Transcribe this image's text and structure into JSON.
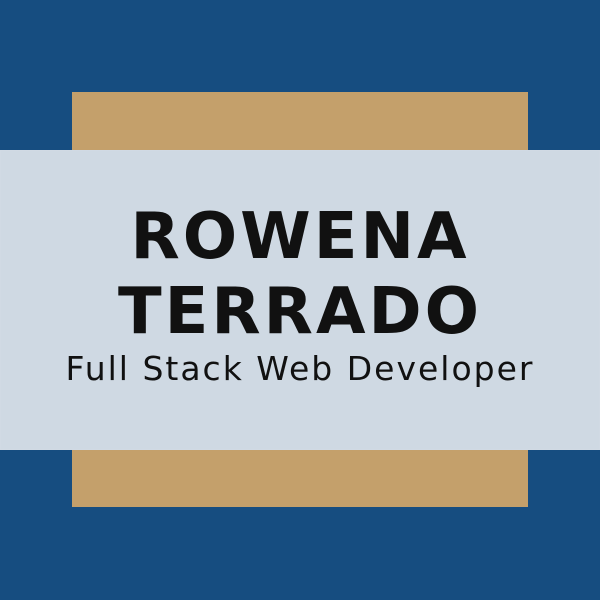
{
  "colors": {
    "background": "#164d80",
    "gold": "#c4a06b",
    "band": "#cfd9e3",
    "text": "#111111"
  },
  "name": {
    "line1": "ROWENA",
    "line2": "TERRADO"
  },
  "subtitle": "Full Stack Web Developer"
}
